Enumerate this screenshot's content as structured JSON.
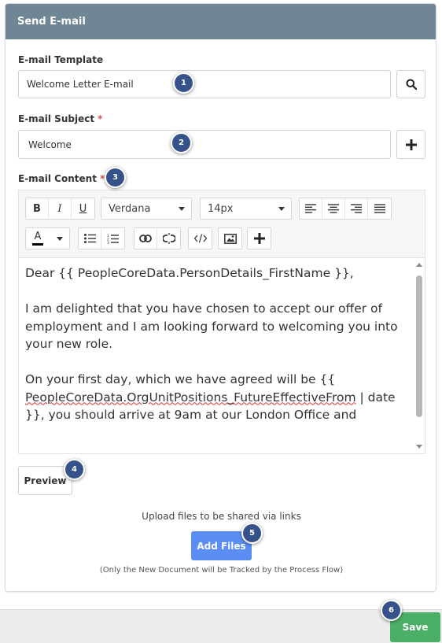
{
  "panel": {
    "title": "Send E-mail"
  },
  "template": {
    "label": "E-mail Template",
    "value": "Welcome Letter E-mail",
    "search_icon": "search-icon"
  },
  "subject": {
    "label": "E-mail Subject",
    "required_mark": "*",
    "value": "Welcome",
    "add_icon": "plus-icon"
  },
  "content": {
    "label": "E-mail Content",
    "required_mark": "*",
    "toolbar": {
      "bold": "B",
      "italic": "I",
      "underline": "U",
      "font_family": "Verdana",
      "font_size": "14px",
      "color_label": "A",
      "text_color": "#000000"
    },
    "body": {
      "line1": "Dear {{ PeopleCoreData.PersonDetails_FirstName }},",
      "line2": "I am delighted that you have chosen to accept our offer of employment and I am looking forward to welcoming you into your new role.",
      "line3_pre": "On your first day, which we have agreed will be {{ ",
      "line3_spell": "PeopleCoreData.OrgUnitPositions_FutureEffectiveFrom",
      "line3_post": " | date }}, you should arrive at 9am at our London Office and"
    }
  },
  "preview_label": "Preview",
  "upload": {
    "text": "Upload files to be shared via links",
    "button": "Add Files",
    "note": "(Only the New Document will be Tracked by the Process Flow)"
  },
  "footer": {
    "save_label": "Save"
  },
  "badges": [
    "1",
    "2",
    "3",
    "4",
    "5",
    "6"
  ],
  "colors": {
    "header": "#6f8794",
    "badge": "#35528a",
    "primary": "#5b8ef5",
    "save": "#4caf68",
    "required": "#d9534f"
  }
}
